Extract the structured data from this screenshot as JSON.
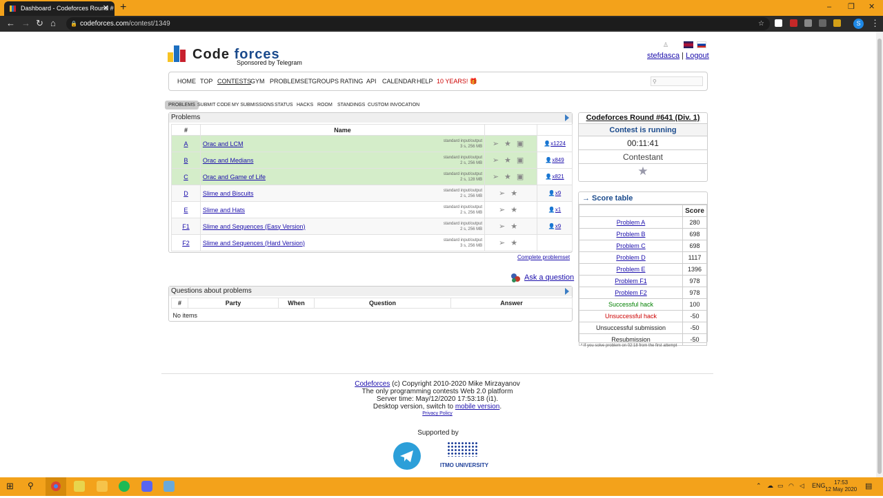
{
  "browser": {
    "tab_title": "Dashboard - Codeforces Round #",
    "tab_close": "✕",
    "new_tab": "+",
    "win_min": "‒",
    "win_max": "❐",
    "win_close": "✕",
    "url_host": "codeforces.com",
    "url_path": "/contest/1349",
    "profile_initial": "S"
  },
  "header": {
    "logo_code": "Code",
    "logo_forces": "forces",
    "sponsor": "Sponsored by Telegram",
    "user": "stefdasca",
    "separator": "|",
    "logout": "Logout"
  },
  "menu": {
    "items": [
      "HOME",
      "TOP",
      "CONTESTS",
      "GYM",
      "PROBLEMSET",
      "GROUPS",
      "RATING",
      "API",
      "CALENDAR",
      "HELP"
    ],
    "years": "10 YEARS! 🎁"
  },
  "subtabs": [
    "PROBLEMS",
    "SUBMIT CODE",
    "MY SUBMISSIONS",
    "STATUS",
    "HACKS",
    "ROOM",
    "STANDINGS",
    "CUSTOM INVOCATION"
  ],
  "problems": {
    "title": "Problems",
    "col_num": "#",
    "col_name": "Name",
    "rows": [
      {
        "idx": "A",
        "name": "Orac and LCM",
        "io": "standard input/output",
        "limits": "3 s, 256 MB",
        "count": "x1224",
        "solved": true
      },
      {
        "idx": "B",
        "name": "Orac and Medians",
        "io": "standard input/output",
        "limits": "2 s, 256 MB",
        "count": "x849",
        "solved": true
      },
      {
        "idx": "C",
        "name": "Orac and Game of Life",
        "io": "standard input/output",
        "limits": "2 s, 128 MB",
        "count": "x821",
        "solved": true
      },
      {
        "idx": "D",
        "name": "Slime and Biscuits",
        "io": "standard input/output",
        "limits": "2 s, 256 MB",
        "count": "x9",
        "solved": false
      },
      {
        "idx": "E",
        "name": "Slime and Hats",
        "io": "standard input/output",
        "limits": "2 s, 256 MB",
        "count": "x1",
        "solved": false
      },
      {
        "idx": "F1",
        "name": "Slime and Sequences (Easy Version)",
        "io": "standard input/output",
        "limits": "2 s, 256 MB",
        "count": "x9",
        "solved": false
      },
      {
        "idx": "F2",
        "name": "Slime and Sequences (Hard Version)",
        "io": "standard input/output",
        "limits": "3 s, 256 MB",
        "count": "",
        "solved": false
      }
    ],
    "complete": "Complete problemset",
    "ask": "Ask a question"
  },
  "questions": {
    "title": "Questions about problems",
    "cols": [
      "#",
      "Party",
      "When",
      "Question",
      "Answer"
    ],
    "empty": "No items"
  },
  "contest": {
    "name": "Codeforces Round #641 (Div. 1)",
    "status": "Contest is running",
    "timer": "00:11:41",
    "role": "Contestant"
  },
  "score": {
    "title": "→ Score table",
    "col": "Score",
    "rows": [
      {
        "label": "Problem A",
        "value": "280",
        "kind": "link"
      },
      {
        "label": "Problem B",
        "value": "698",
        "kind": "link"
      },
      {
        "label": "Problem C",
        "value": "698",
        "kind": "link"
      },
      {
        "label": "Problem D",
        "value": "1117",
        "kind": "link"
      },
      {
        "label": "Problem E",
        "value": "1396",
        "kind": "link"
      },
      {
        "label": "Problem F1",
        "value": "978",
        "kind": "link"
      },
      {
        "label": "Problem F2",
        "value": "978",
        "kind": "link"
      },
      {
        "label": "Successful hack",
        "value": "100",
        "kind": "green"
      },
      {
        "label": "Unsuccessful hack",
        "value": "-50",
        "kind": "red"
      },
      {
        "label": "Unsuccessful submission",
        "value": "-50",
        "kind": "plain"
      },
      {
        "label": "Resubmission",
        "value": "-50",
        "kind": "plain"
      }
    ],
    "footnote": "* If you solve problem on 02:18 from the first attempt"
  },
  "footer": {
    "brand": "Codeforces",
    "copyright": " (c) Copyright 2010-2020 Mike Mirzayanov",
    "line2": "The only programming contests Web 2.0 platform",
    "line3": "Server time: May/12/2020 17:53:18 (i1).",
    "line4_pre": "Desktop version, switch to ",
    "mobile": "mobile version",
    "line4_post": ".",
    "privacy": "Privacy Policy",
    "supported": "Supported by",
    "itmo": "ITMO UNIVERSITY"
  },
  "taskbar": {
    "lang": "ENG",
    "time": "17:53",
    "date": "12 May 2020"
  },
  "colors": {
    "tabbar": "#f3a21b",
    "solved": "#d4edc9",
    "link": "#1a0dab",
    "green": "#008000",
    "red": "#cc0000"
  }
}
